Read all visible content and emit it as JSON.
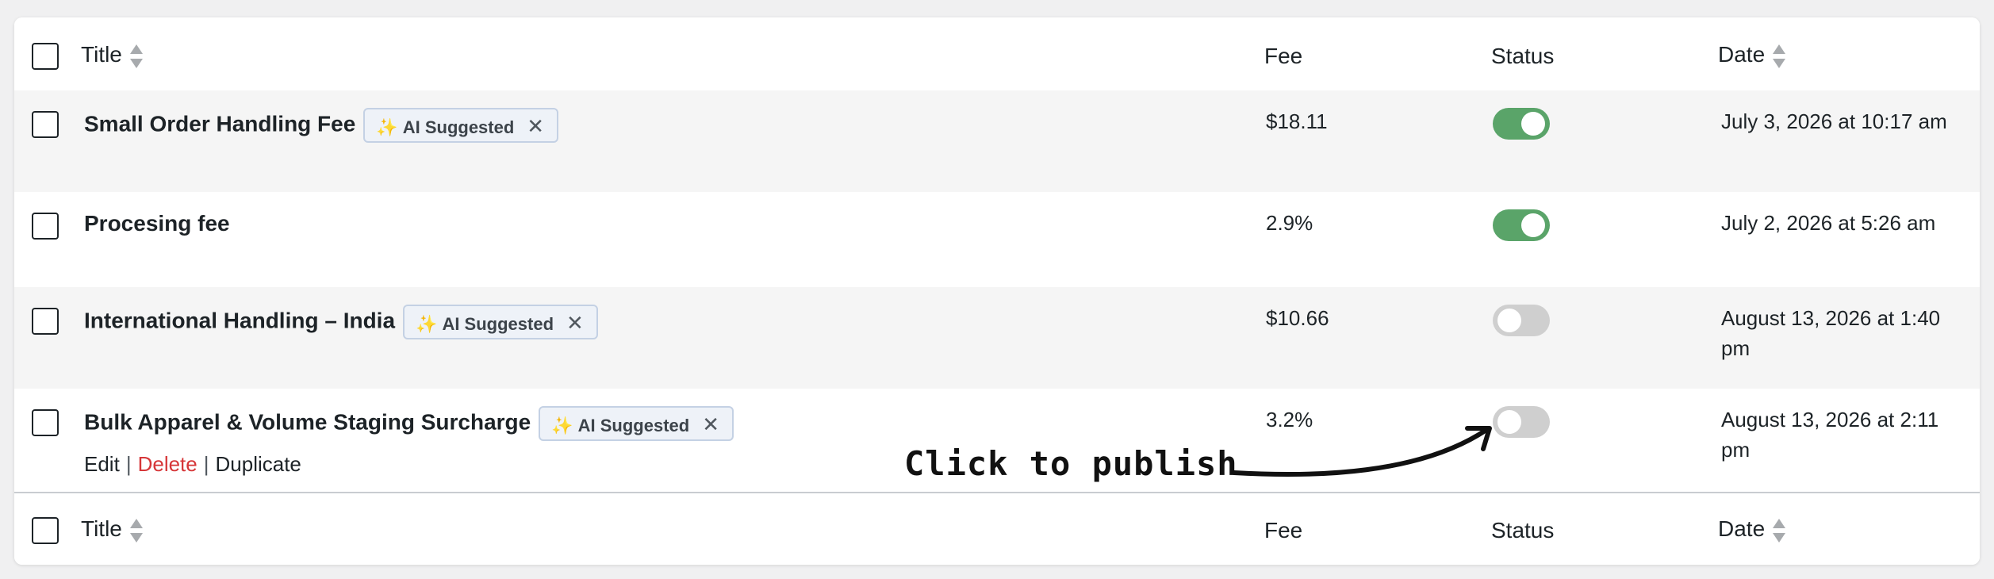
{
  "table": {
    "columns": {
      "title": "Title",
      "fee": "Fee",
      "status": "Status",
      "date": "Date"
    },
    "badge": {
      "label": "AI Suggested"
    },
    "rows": [
      {
        "title": "Small Order Handling Fee",
        "ai_suggested": true,
        "fee": "$18.11",
        "status": "on",
        "date": "July 3, 2026 at 10:17 am"
      },
      {
        "title": "Procesing fee",
        "ai_suggested": false,
        "fee": "2.9%",
        "status": "on",
        "date": "July 2, 2026 at 5:26 am"
      },
      {
        "title": "International Handling – India",
        "ai_suggested": true,
        "fee": "$10.66",
        "status": "off",
        "date": "August 13, 2026 at 1:40 pm"
      },
      {
        "title": "Bulk Apparel & Volume Staging Surcharge",
        "ai_suggested": true,
        "fee": "3.2%",
        "status": "off",
        "date": "August 13, 2026 at 2:11 pm"
      }
    ],
    "row_actions": {
      "edit": "Edit",
      "delete": "Delete",
      "duplicate": "Duplicate",
      "separator": "|"
    }
  },
  "annotation": {
    "text": "Click to publish"
  },
  "icons": {
    "sort": "sort-arrows-icon",
    "sparkle": "sparkle-icon",
    "remove": "close-icon"
  },
  "colors": {
    "toggle_on": "#5aa469",
    "toggle_off": "#cfcfcf",
    "delete_link": "#d63638",
    "badge_bg": "#eef2f8",
    "badge_border": "#c4d1e4",
    "sparkle": "#f0a33a"
  }
}
